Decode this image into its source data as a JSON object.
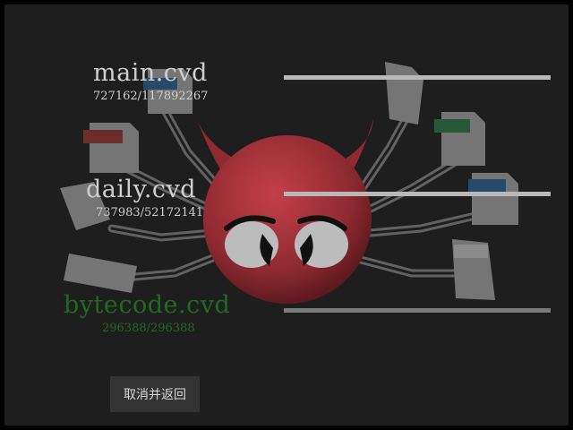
{
  "databases": [
    {
      "name": "main.cvd",
      "progress_label": "727162/117892267",
      "progress_fraction": 1.0,
      "state": "downloading"
    },
    {
      "name": "daily.cvd",
      "progress_label": "737983/52172141",
      "progress_fraction": 1.0,
      "state": "downloading"
    },
    {
      "name": "bytecode.cvd",
      "progress_label": "296388/296388",
      "progress_fraction": 1.0,
      "state": "complete"
    }
  ],
  "file_icons": [
    "JS",
    "PDF",
    "XLS",
    "DOCX",
    "PPT"
  ],
  "cancel_button": {
    "label": "取消并返回"
  },
  "colors": {
    "background": "#1e1e1e",
    "frame": "#000000",
    "text_active": "#cfcfcf",
    "text_complete": "#1f6b1f",
    "bar_fill": "#b8b8b8",
    "bar_fill_complete": "#7a7a7a",
    "mascot_red": "#a8333b"
  },
  "icons": [
    "clamav-mascot-icon"
  ]
}
